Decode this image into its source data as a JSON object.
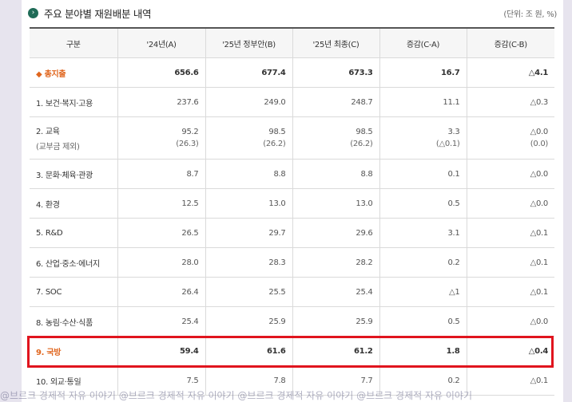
{
  "header": {
    "icon": "chevron-right-circle-icon",
    "title": "주요 분야별 재원배분 내역",
    "unit": "(단위: 조 원, %)"
  },
  "table": {
    "columns": [
      "구분",
      "'24년(A)",
      "'25년 정부안(B)",
      "'25년 최종(C)",
      "증감(C-A)",
      "증감(C-B)"
    ],
    "rows": [
      {
        "label": "◆ 총지출",
        "a": "656.6",
        "b": "677.4",
        "c": "673.3",
        "ca": "16.7",
        "cb": "△4.1"
      },
      {
        "label": "1. 보건·복지·고용",
        "a": "237.6",
        "b": "249.0",
        "c": "248.7",
        "ca": "11.1",
        "cb": "△0.3"
      },
      {
        "label": "2. 교육",
        "label_sub": "(교부금 제외)",
        "a": "95.2",
        "a_sub": "(26.3)",
        "b": "98.5",
        "b_sub": "(26.2)",
        "c": "98.5",
        "c_sub": "(26.2)",
        "ca": "3.3",
        "ca_sub": "(△0.1)",
        "cb": "△0.0",
        "cb_sub": "(0.0)"
      },
      {
        "label": "3. 문화·체육·관광",
        "a": "8.7",
        "b": "8.8",
        "c": "8.8",
        "ca": "0.1",
        "cb": "△0.0"
      },
      {
        "label": "4. 환경",
        "a": "12.5",
        "b": "13.0",
        "c": "13.0",
        "ca": "0.5",
        "cb": "△0.0"
      },
      {
        "label": "5. R&D",
        "a": "26.5",
        "b": "29.7",
        "c": "29.6",
        "ca": "3.1",
        "cb": "△0.1"
      },
      {
        "label": "6. 산업·중소·에너지",
        "a": "28.0",
        "b": "28.3",
        "c": "28.2",
        "ca": "0.2",
        "cb": "△0.1"
      },
      {
        "label": "7. SOC",
        "a": "26.4",
        "b": "25.5",
        "c": "25.4",
        "ca": "△1",
        "cb": "△0.1"
      },
      {
        "label": "8. 농림·수산·식품",
        "a": "25.4",
        "b": "25.9",
        "c": "25.9",
        "ca": "0.5",
        "cb": "△0.0"
      },
      {
        "label": "9. 국방",
        "a": "59.4",
        "b": "61.6",
        "c": "61.2",
        "ca": "1.8",
        "cb": "△0.4"
      },
      {
        "label": "10. 외교·통일",
        "a": "7.5",
        "b": "7.8",
        "c": "7.7",
        "ca": "0.2",
        "cb": "△0.1"
      }
    ]
  },
  "watermark": "@브르크 경제적 자유 이야기    @브르크 경제적 자유 이야기    @브르크 경제적 자유 이야기    @브르크 경제적 자유 이야기",
  "colors": {
    "highlight": "#e0141e",
    "accent": "#e0661e",
    "icon": "#1f6b57"
  }
}
